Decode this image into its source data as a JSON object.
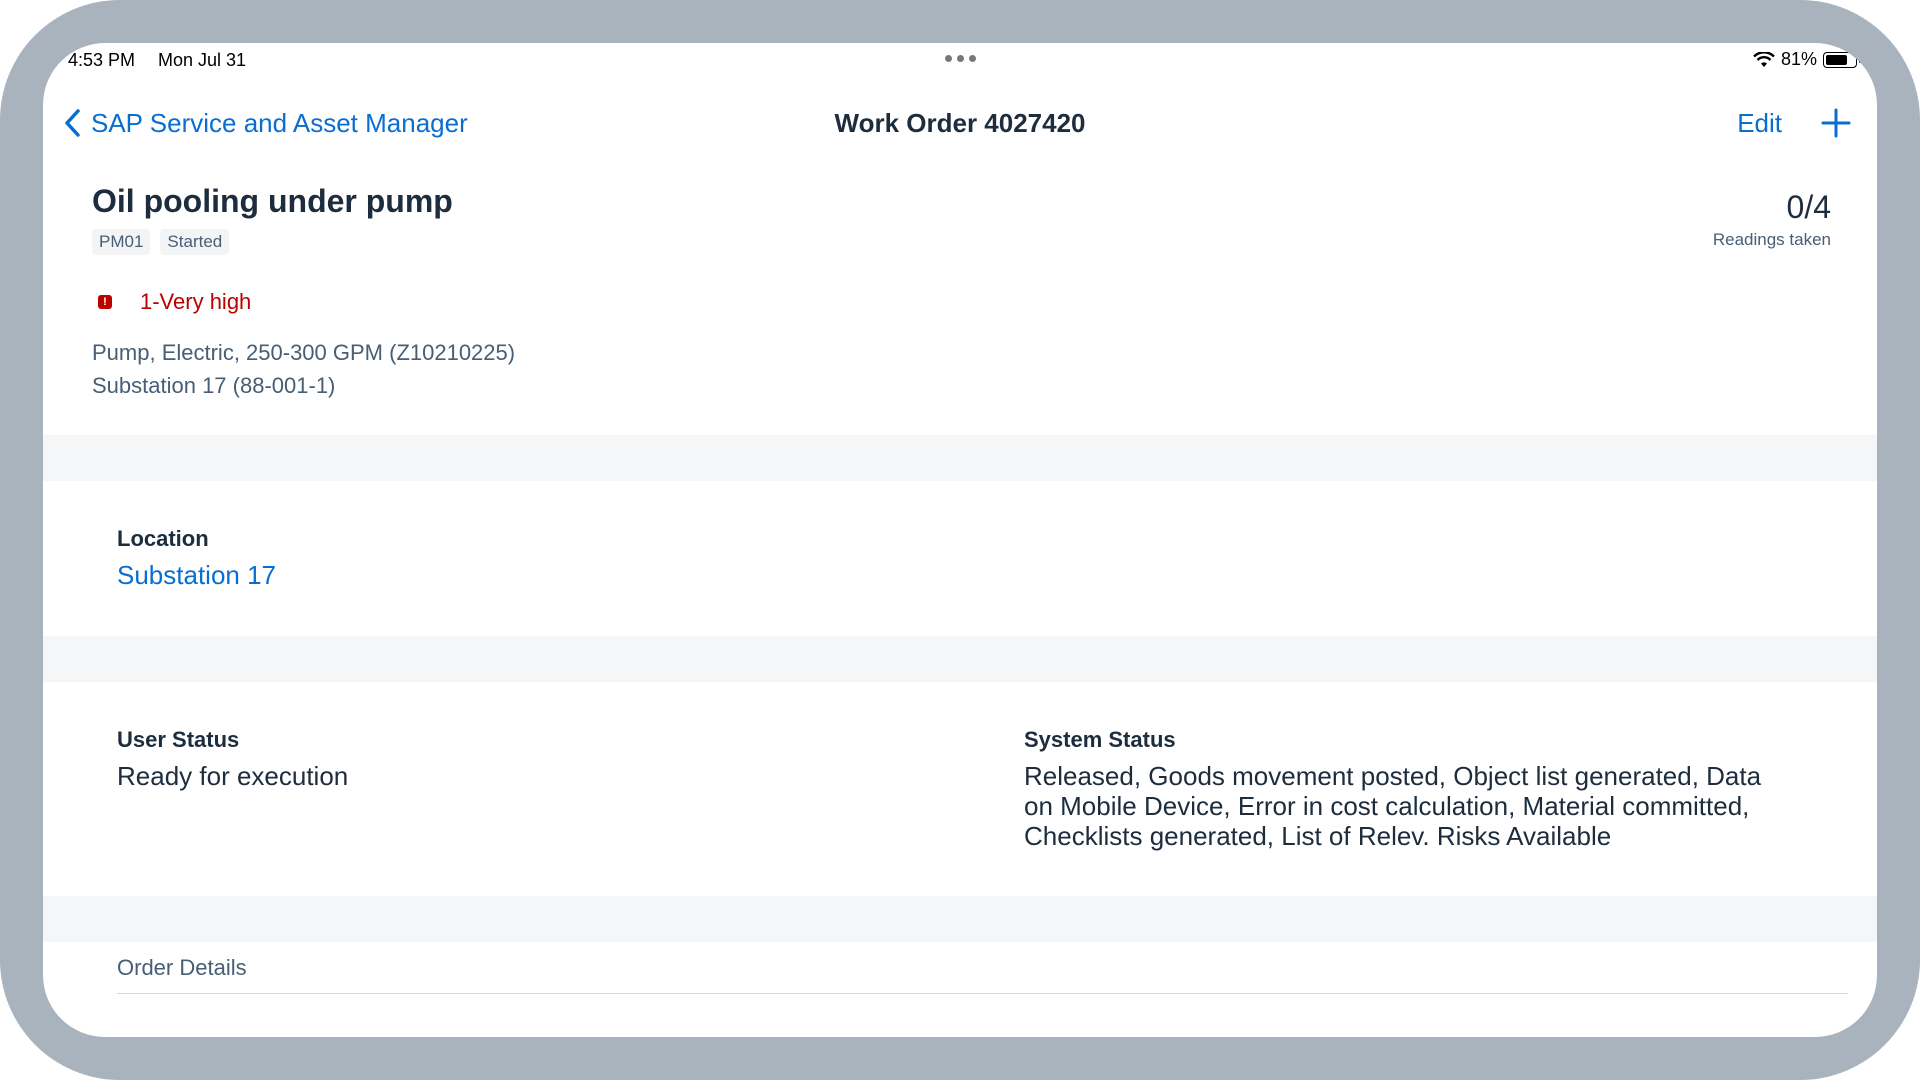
{
  "status_bar": {
    "time": "4:53 PM",
    "date": "Mon Jul 31",
    "battery_percent": "81%",
    "battery_level": 0.81
  },
  "nav": {
    "back_label": "SAP Service and Asset Manager",
    "title": "Work Order 4027420",
    "edit_label": "Edit"
  },
  "header": {
    "title": "Oil pooling under pump",
    "tags": [
      "PM01",
      "Started"
    ],
    "readings_value": "0/4",
    "readings_label": "Readings taken",
    "priority": "1-Very high",
    "priority_color": "#bb0000",
    "equipment": "Pump, Electric, 250-300 GPM (Z10210225)",
    "functional_location": "Substation 17 (88-001-1)"
  },
  "location": {
    "label": "Location",
    "value": "Substation 17"
  },
  "status": {
    "user_label": "User Status",
    "user_value": "Ready for execution",
    "system_label": "System Status",
    "system_value": "Released, Goods movement posted, Object list generated, Data on Mobile Device, Error in cost calculation, Material committed, Checklists generated, List of Relev. Risks Available"
  },
  "sections": {
    "order_details": "Order Details"
  },
  "colors": {
    "accent": "#0a6ed1",
    "frame": "#a8b3be",
    "separator": "#f5f6f7"
  }
}
